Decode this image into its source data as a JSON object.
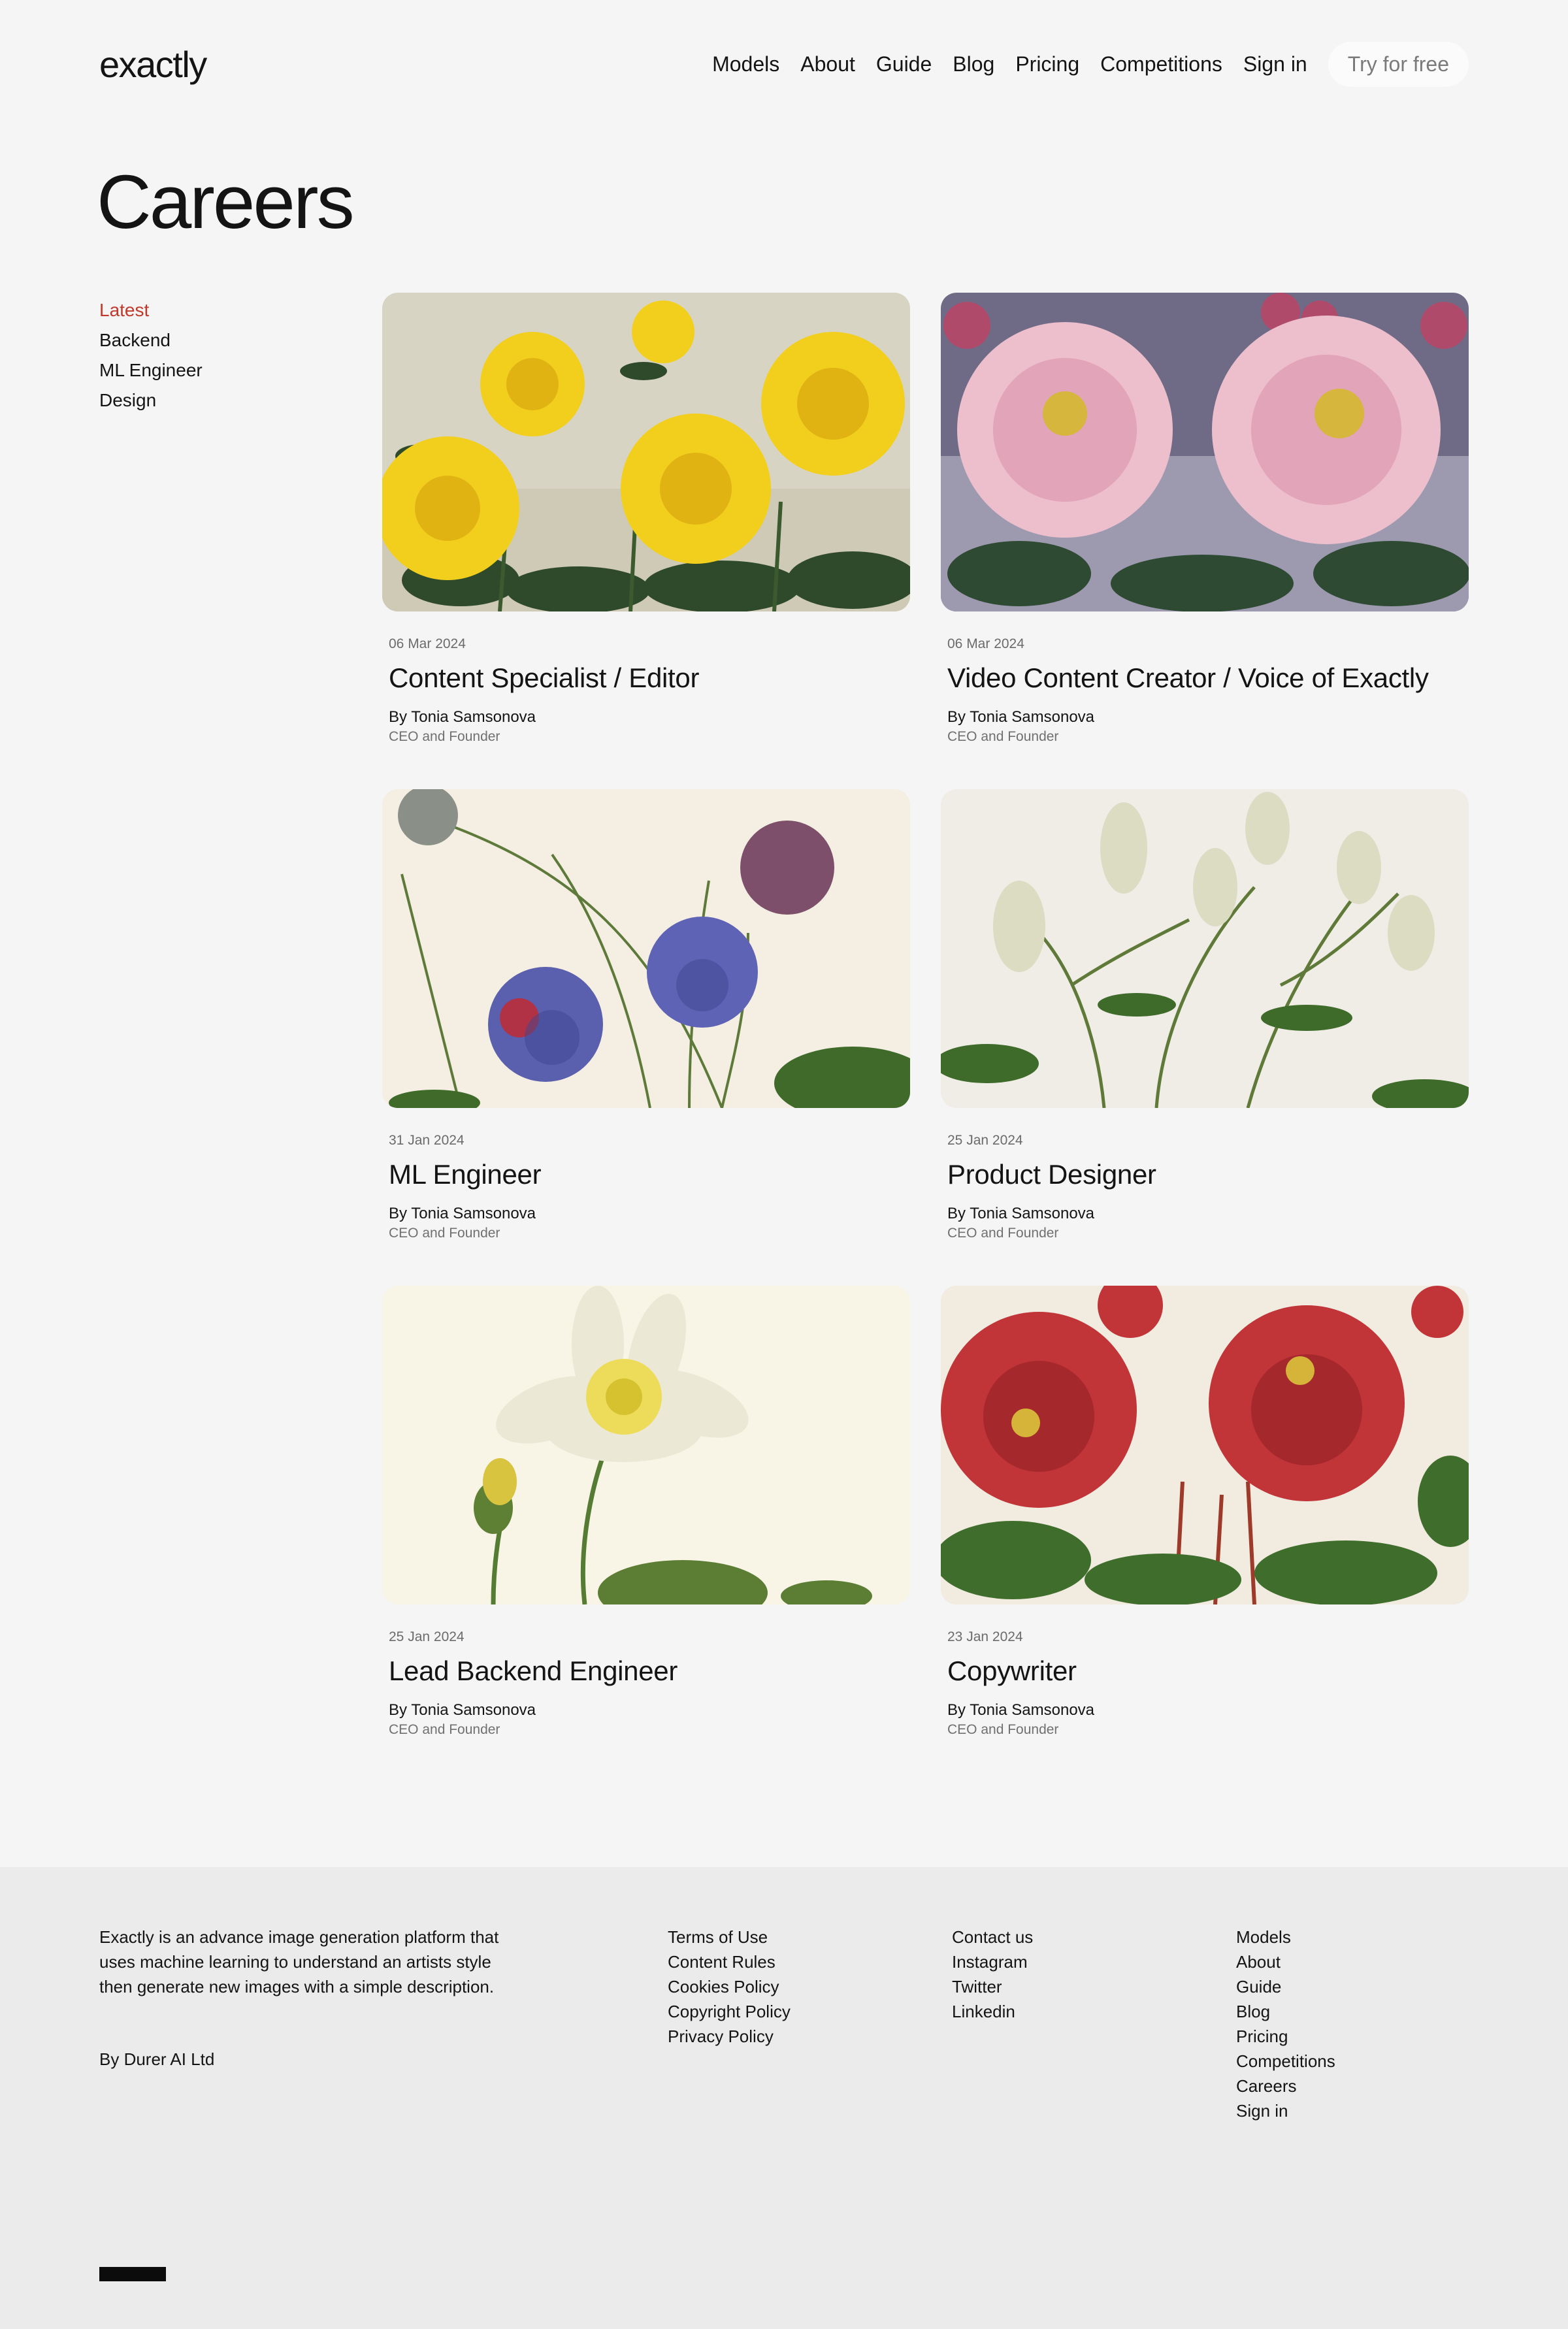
{
  "header": {
    "logo": "exactly",
    "nav": [
      "Models",
      "About",
      "Guide",
      "Blog",
      "Pricing",
      "Competitions",
      "Sign in"
    ],
    "cta": "Try for free"
  },
  "page_title": "Careers",
  "sidebar": {
    "items": [
      "Latest",
      "Backend",
      "ML Engineer",
      "Design"
    ],
    "active": "Latest"
  },
  "posts": [
    {
      "date": "06 Mar 2024",
      "title": "Content Specialist / Editor",
      "author": "By Tonia Samsonova",
      "role": "CEO and Founder",
      "image": "yellow-roses"
    },
    {
      "date": "06 Mar 2024",
      "title": "Video Content Creator / Voice of Exactly",
      "author": "By Tonia Samsonova",
      "role": "CEO and Founder",
      "image": "pink-peonies"
    },
    {
      "date": "31 Jan 2024",
      "title": "ML Engineer",
      "author": "By Tonia Samsonova",
      "role": "CEO and Founder",
      "image": "blackberries"
    },
    {
      "date": "25 Jan 2024",
      "title": "Product Designer",
      "author": "By Tonia Samsonova",
      "role": "CEO and Founder",
      "image": "white-lilies"
    },
    {
      "date": "25 Jan 2024",
      "title": "Lead Backend Engineer",
      "author": "By Tonia Samsonova",
      "role": "CEO and Founder",
      "image": "lotus"
    },
    {
      "date": "23 Jan 2024",
      "title": "Copywriter",
      "author": "By Tonia Samsonova",
      "role": "CEO and Founder",
      "image": "red-roses"
    }
  ],
  "footer": {
    "description": "Exactly is an advance image generation platform that uses machine learning to understand an artists style then generate new images with a simple description.",
    "by": "By Durer AI Ltd",
    "legal": [
      "Terms of Use",
      "Content Rules",
      "Cookies Policy",
      "Copyright Policy",
      "Privacy Policy"
    ],
    "social": [
      "Contact us",
      "Instagram",
      "Twitter",
      "Linkedin"
    ],
    "site": [
      "Models",
      "About",
      "Guide",
      "Blog",
      "Pricing",
      "Competitions",
      "Careers",
      "Sign in"
    ]
  },
  "colors": {
    "background": "#f5f5f5",
    "footer_background": "#ebebeb",
    "accent": "#c0392b",
    "text": "#141414"
  }
}
